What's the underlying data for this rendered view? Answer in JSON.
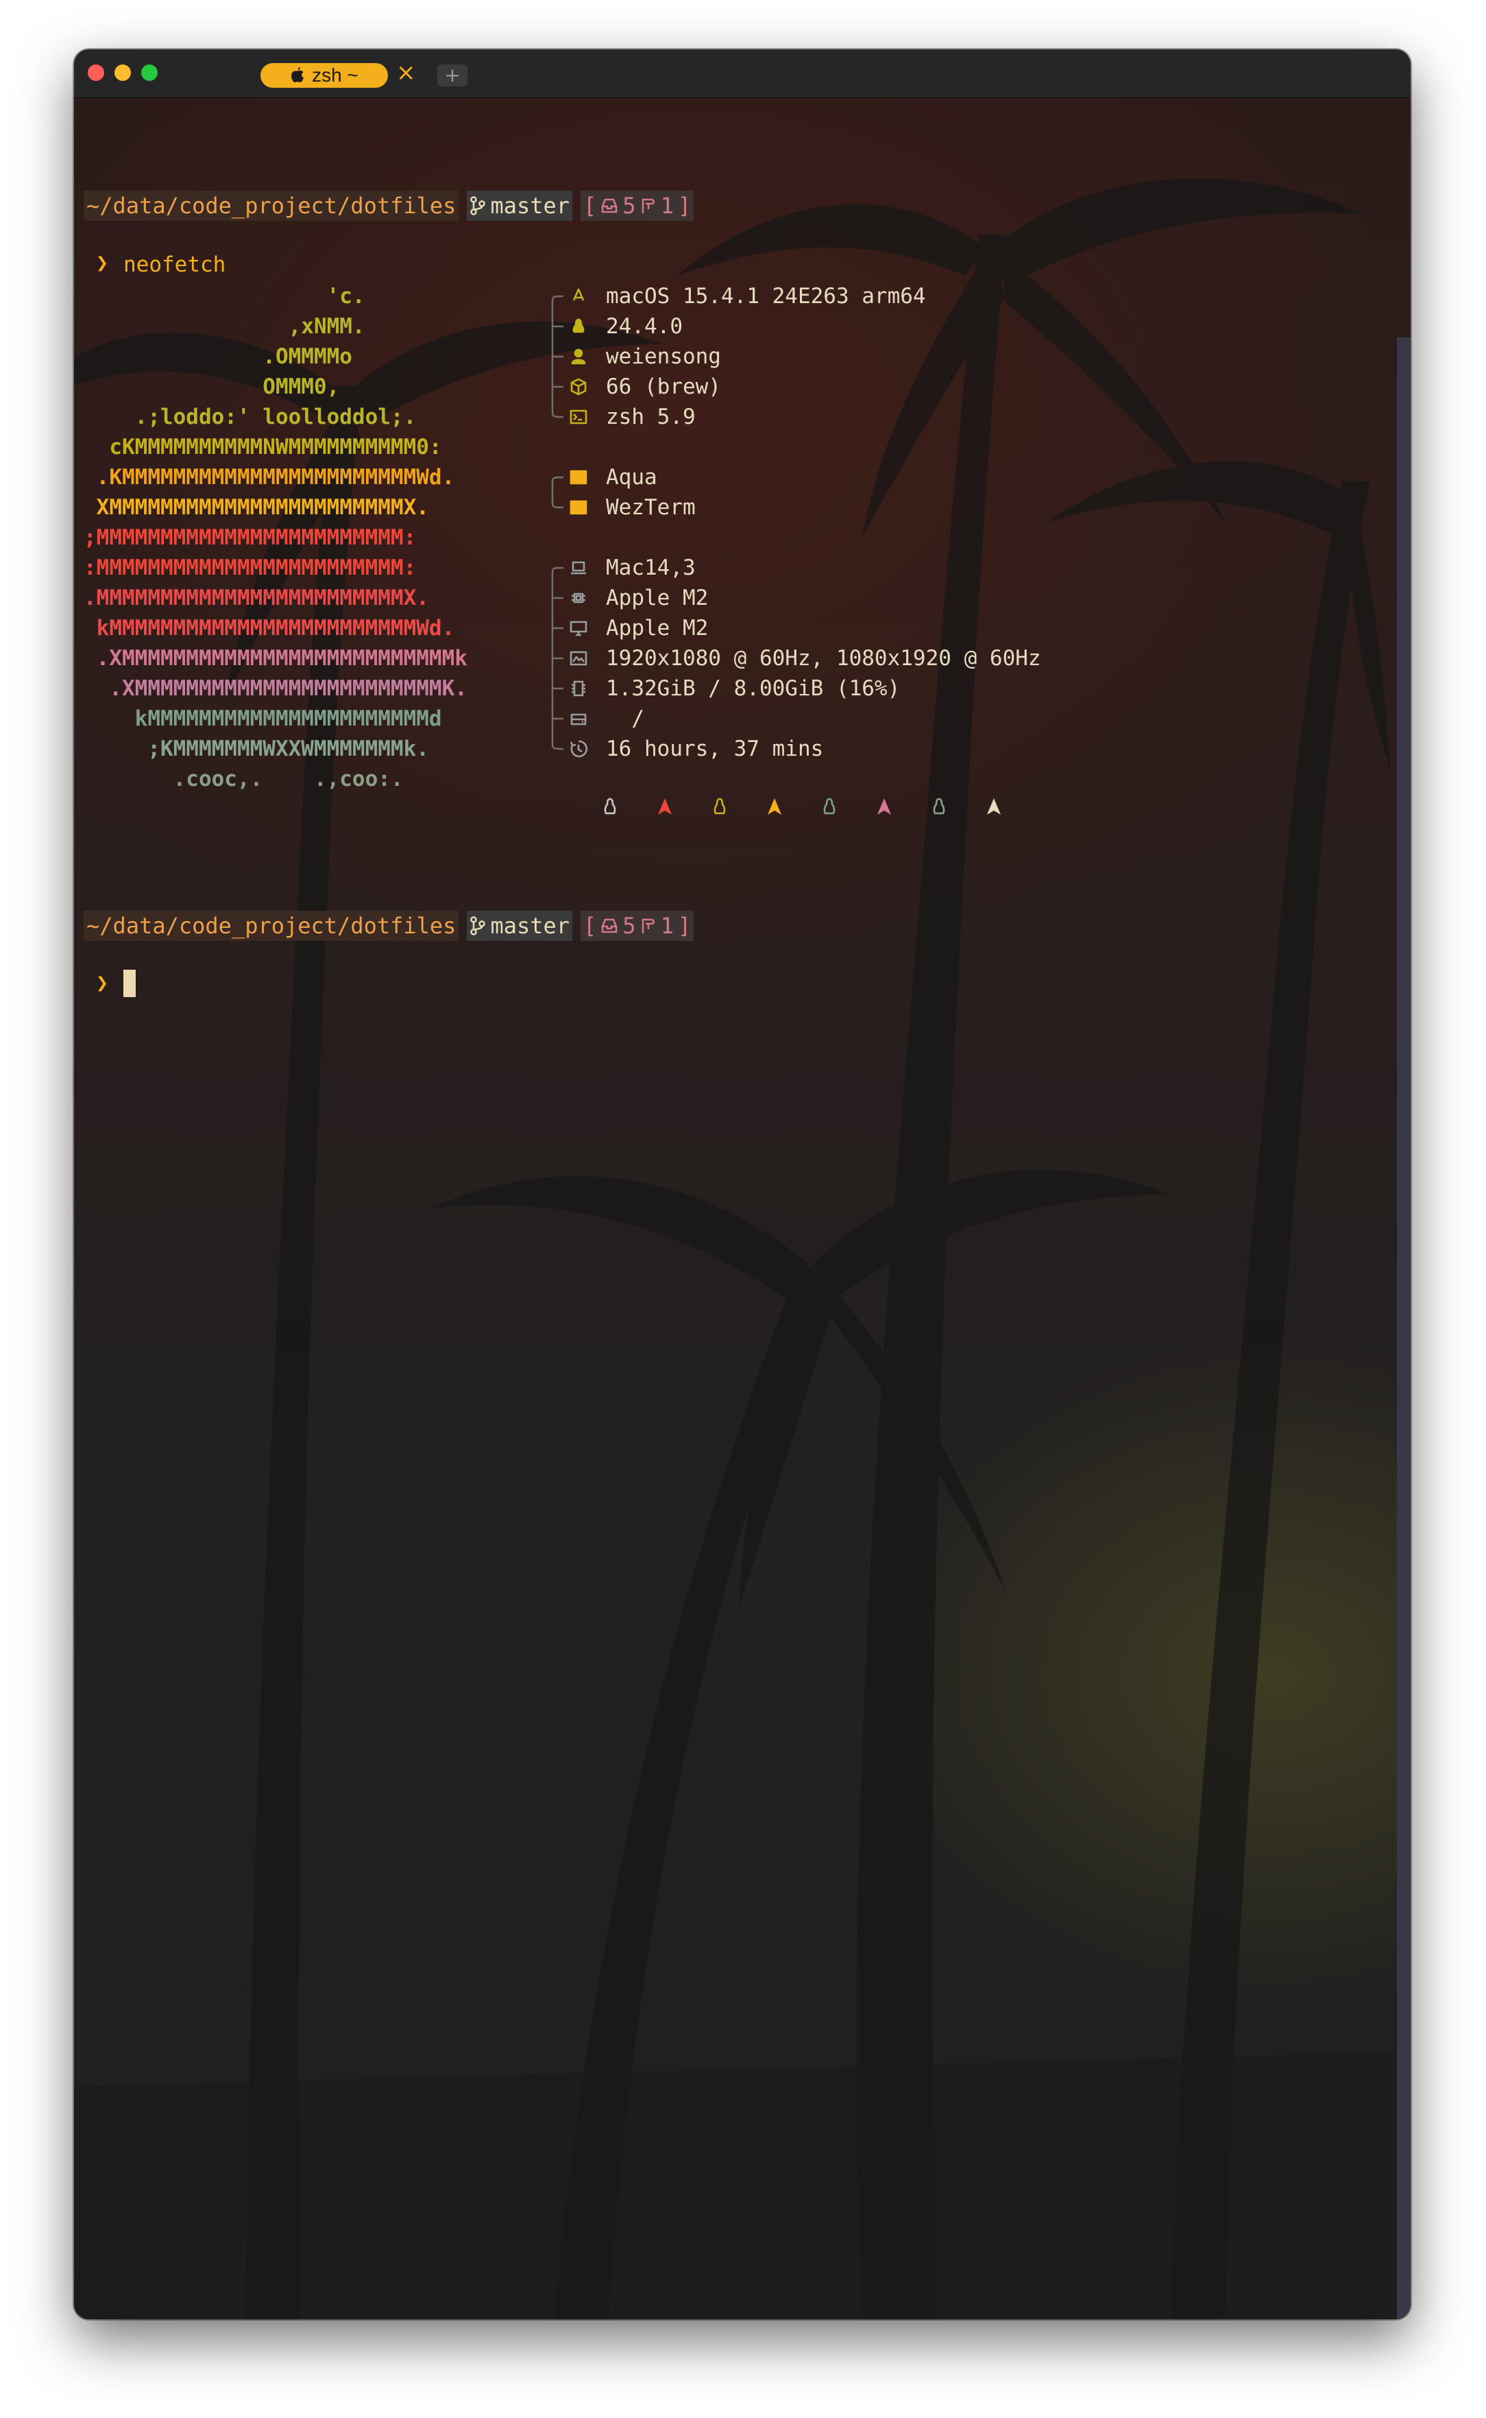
{
  "window": {
    "tab_label": "zsh ~",
    "tab_close": "×",
    "new_tab": "+"
  },
  "prompt": {
    "path": "~/data/code_project/dotfiles",
    "branch": "master",
    "stash_count": "5",
    "ahead_count": "1",
    "prompt_char": "❯",
    "command": "neofetch"
  },
  "ascii_logo": [
    {
      "text": "                   'c.",
      "color": "#b9b428"
    },
    {
      "text": "                ,xNMM.",
      "color": "#b9b428"
    },
    {
      "text": "              .OMMMMo",
      "color": "#b9b428"
    },
    {
      "text": "              OMMM0,",
      "color": "#b9b428"
    },
    {
      "text": "    .;loddo:' loolloddol;.",
      "color": "#b9b428"
    },
    {
      "text": "  cKMMMMMMMMMMNWMMMMMMMMMM0:",
      "color": "#c4b21a"
    },
    {
      "text": " .KMMMMMMMMMMMMMMMMMMMMMMMWd.",
      "color": "#f0a21c"
    },
    {
      "text": " XMMMMMMMMMMMMMMMMMMMMMMMX.",
      "color": "#f4b01a"
    },
    {
      "text": ";MMMMMMMMMMMMMMMMMMMMMMMM:",
      "color": "#f0463a"
    },
    {
      "text": ":MMMMMMMMMMMMMMMMMMMMMMMM:",
      "color": "#f0463a"
    },
    {
      "text": ".MMMMMMMMMMMMMMMMMMMMMMMMX.",
      "color": "#ec4a4a"
    },
    {
      "text": " kMMMMMMMMMMMMMMMMMMMMMMMMWd.",
      "color": "#ef4a4a"
    },
    {
      "text": " .XMMMMMMMMMMMMMMMMMMMMMMMMMMk",
      "color": "#d37890"
    },
    {
      "text": "  .XMMMMMMMMMMMMMMMMMMMMMMMMK.",
      "color": "#c47f9e"
    },
    {
      "text": "    kMMMMMMMMMMMMMMMMMMMMMMd",
      "color": "#7ea08b"
    },
    {
      "text": "     ;KMMMMMMMWXXWMMMMMMMk.",
      "color": "#8aa58f"
    },
    {
      "text": "       .cooc,.    .,coo:.",
      "color": "#8d9e88"
    }
  ],
  "info": [
    {
      "icon": "apple-logo-icon",
      "value": "macOS 15.4.1 24E263 arm64",
      "color": "#c4b21a"
    },
    {
      "icon": "tux-icon",
      "value": "24.4.0",
      "color": "#c4b21a"
    },
    {
      "icon": "user-icon",
      "value": "weiensong",
      "color": "#c4b21a"
    },
    {
      "icon": "package-icon",
      "value": "66 (brew)",
      "color": "#c4b21a"
    },
    {
      "icon": "terminal-icon",
      "value": "zsh 5.9",
      "color": "#c4b21a"
    },
    {
      "icon": "window-icon",
      "value": "Aqua",
      "color": "#f4b01a"
    },
    {
      "icon": "terminal-app-icon",
      "value": "WezTerm",
      "color": "#f4b01a"
    },
    {
      "icon": "laptop-icon",
      "value": "Mac14,3",
      "color": "#9a9ea0"
    },
    {
      "icon": "cpu-icon",
      "value": "Apple M2",
      "color": "#9a9ea0"
    },
    {
      "icon": "monitor-icon",
      "value": "Apple M2",
      "color": "#9a9ea0"
    },
    {
      "icon": "display-icon",
      "value": "1920x1080 @ 60Hz, 1080x1920 @ 60Hz",
      "color": "#9a9ea0"
    },
    {
      "icon": "memory-icon",
      "value": "1.32GiB / 8.00GiB (16%)",
      "color": "#9a9ea0"
    },
    {
      "icon": "disk-icon",
      "value": "  /",
      "color": "#9a9ea0"
    },
    {
      "icon": "uptime-icon",
      "value": "16 hours, 37 mins",
      "color": "#9a9ea0"
    }
  ],
  "color_blocks": [
    {
      "icon": "tux-icon",
      "color": "#c9c9c9"
    },
    {
      "icon": "arch-icon",
      "color": "#f0463a"
    },
    {
      "icon": "tux-icon",
      "color": "#c4b21a"
    },
    {
      "icon": "arch-icon",
      "color": "#f4b01a"
    },
    {
      "icon": "tux-icon",
      "color": "#7ea08b"
    },
    {
      "icon": "arch-icon",
      "color": "#d37890"
    },
    {
      "icon": "tux-icon",
      "color": "#8aa58f"
    },
    {
      "icon": "arch-icon",
      "color": "#e6dcc0"
    }
  ],
  "colors": {
    "accent": "#f4b01a",
    "path_fg": "#f0a04b",
    "status_fg": "#d47a84"
  }
}
